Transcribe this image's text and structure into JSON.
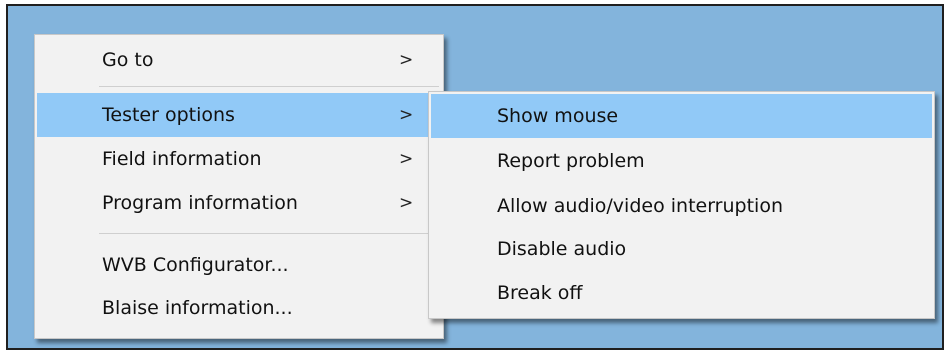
{
  "main_menu": {
    "items": [
      {
        "label": "Go to",
        "arrow": ">"
      },
      {
        "label": "Tester options",
        "arrow": ">"
      },
      {
        "label": "Field  information",
        "arrow": ">"
      },
      {
        "label": "Program information",
        "arrow": ">"
      },
      {
        "label": "WVB Configurator..."
      },
      {
        "label": "Blaise information..."
      }
    ]
  },
  "sub_menu": {
    "items": [
      {
        "label": "Show mouse"
      },
      {
        "label": "Report problem"
      },
      {
        "label": "Allow audio/video interruption"
      },
      {
        "label": "Disable audio"
      },
      {
        "label": "Break off"
      }
    ]
  },
  "colors": {
    "background": "#83b4dc",
    "menu_bg": "#f2f2f2",
    "highlight": "#91c9f7"
  }
}
